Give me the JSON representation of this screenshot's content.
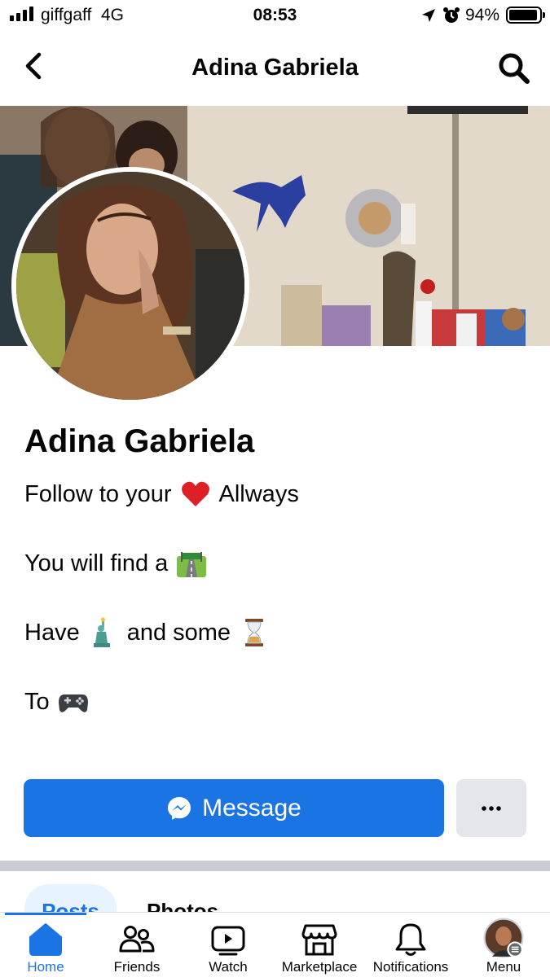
{
  "status_bar": {
    "carrier": "giffgaff",
    "network": "4G",
    "time": "08:53",
    "battery_percent": "94%",
    "battery_level": 0.94
  },
  "header": {
    "title": "Adina Gabriela",
    "icons": {
      "back": "chevron-left-icon",
      "search": "search-icon"
    }
  },
  "profile": {
    "name": "Adina Gabriela",
    "bio": [
      {
        "text_before": "Follow to your",
        "emoji": "red-heart",
        "text_after": "Allways"
      },
      {
        "text_before": "You will find a",
        "emoji": "motorway",
        "text_after": ""
      },
      {
        "text_before": "Have",
        "emoji": "statue-of-liberty",
        "text_after": "and some",
        "emoji2": "hourglass"
      },
      {
        "text_before": "To",
        "emoji": "video-game-controller",
        "text_after": ""
      }
    ]
  },
  "actions": {
    "message_label": "Message",
    "message_icon": "messenger-icon",
    "more_icon": "more-dots-icon"
  },
  "profile_tabs": [
    {
      "label": "Posts",
      "active": true
    },
    {
      "label": "Photos",
      "active": false
    }
  ],
  "bottom_nav": [
    {
      "label": "Home",
      "icon": "home-icon",
      "active": true
    },
    {
      "label": "Friends",
      "icon": "friends-icon",
      "active": false
    },
    {
      "label": "Watch",
      "icon": "watch-icon",
      "active": false
    },
    {
      "label": "Marketplace",
      "icon": "marketplace-icon",
      "active": false
    },
    {
      "label": "Notifications",
      "icon": "bell-icon",
      "active": false
    },
    {
      "label": "Menu",
      "icon": "menu-avatar-icon",
      "active": false
    }
  ],
  "colors": {
    "accent": "#1b74e4",
    "tab_active_bg": "#e7f3ff",
    "button_secondary_bg": "#e4e6eb",
    "divider": "#c9ccd1"
  }
}
